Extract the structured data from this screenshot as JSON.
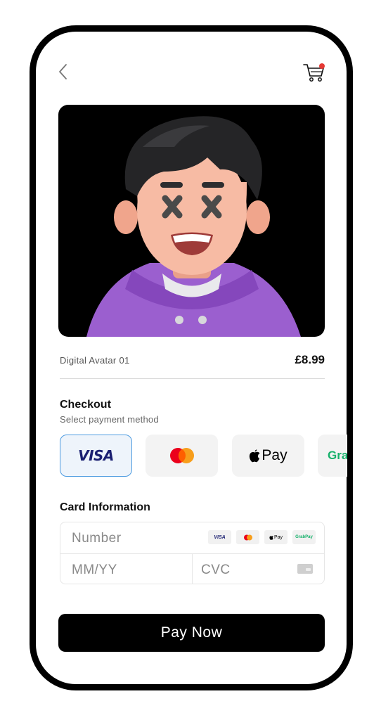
{
  "product": {
    "name": "Digital Avatar 01",
    "price": "£8.99"
  },
  "checkout": {
    "title": "Checkout",
    "subtitle": "Select payment method"
  },
  "payment_methods": [
    {
      "id": "visa",
      "label": "VISA",
      "selected": true
    },
    {
      "id": "mastercard",
      "label": "",
      "selected": false
    },
    {
      "id": "apple-pay",
      "label": "Pay",
      "selected": false
    },
    {
      "id": "grab-pay",
      "label": "Gra",
      "selected": false
    }
  ],
  "card_info": {
    "title": "Card Information",
    "number_placeholder": "Number",
    "expiry_placeholder": "MM/YY",
    "cvc_placeholder": "CVC",
    "mini_logos": {
      "visa": "VISA",
      "apple_pay": "Pay",
      "grab_pay": "GrabPay"
    }
  },
  "pay_button": {
    "label": "Pay Now"
  },
  "icons": {
    "back": "chevron-left-icon",
    "cart": "cart-icon",
    "cart_badge": "notification-dot",
    "cvc": "card-icon"
  },
  "colors": {
    "accent_selected_border": "#4d9be0",
    "cart_badge": "#e53935",
    "visa_blue": "#1a1f71",
    "mastercard_red": "#eb001b",
    "mastercard_orange": "#f79e1b",
    "grab_green": "#16b16b"
  }
}
